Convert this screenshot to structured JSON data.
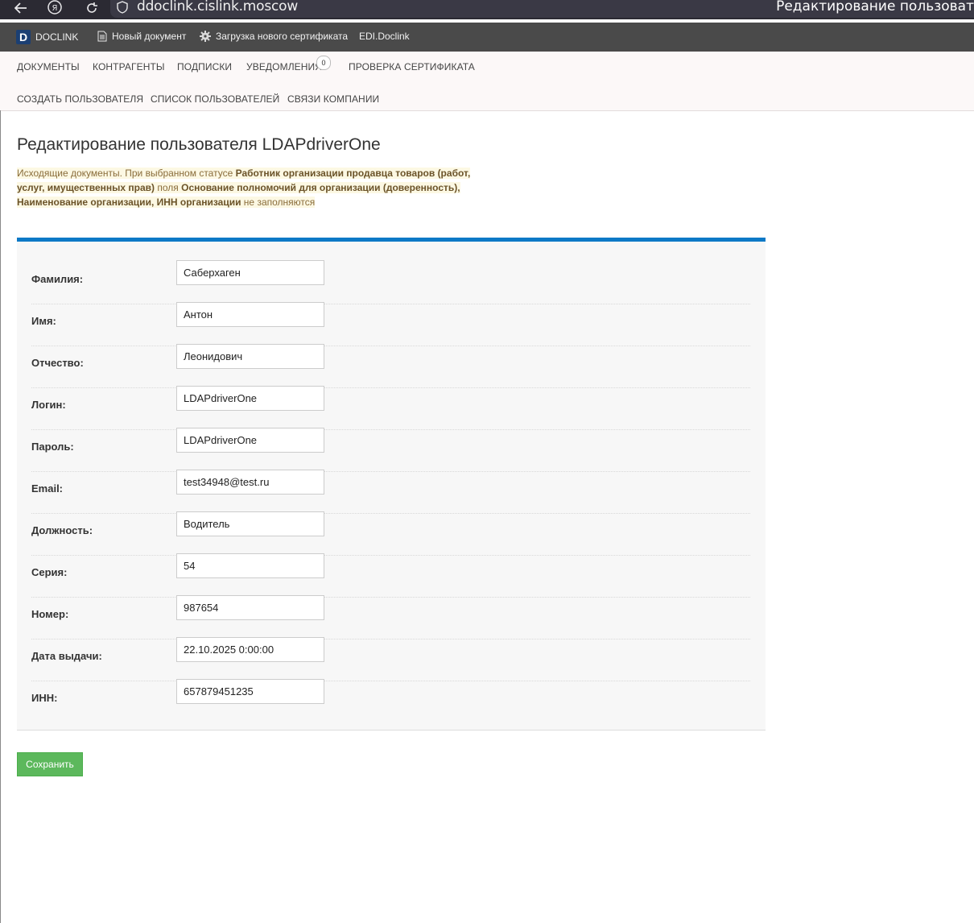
{
  "browser": {
    "url": "ddoclink.cislink.moscow",
    "window_title": "Редактирование пользоват"
  },
  "bookmarks": {
    "items": [
      {
        "label": "DOCLINK",
        "icon": "doclink-logo-icon"
      },
      {
        "label": "Новый документ",
        "icon": "document-icon"
      },
      {
        "label": "Загрузка нового сертификата",
        "icon": "gear-icon"
      },
      {
        "label": "EDI.Doclink"
      }
    ]
  },
  "nav": {
    "row1": [
      "ДОКУМЕНТЫ",
      "КОНТРАГЕНТЫ",
      "ПОДПИСКИ",
      "УВЕДОМЛЕНИЯ",
      "ПРОВЕРКА СЕРТИФИКАТА"
    ],
    "notifications_count": "0",
    "row2": [
      "СОЗДАТЬ ПОЛЬЗОВАТЕЛЯ",
      "СПИСОК ПОЛЬЗОВАТЕЛЕЙ",
      "СВЯЗИ КОМПАНИИ"
    ]
  },
  "page": {
    "title": "Редактирование пользователя LDAPdriverOne",
    "notice": {
      "p1": "Исходящие документы. При выбранном статусе ",
      "b1a": "Работник организации продавца товаров (работ,",
      "b1b": "услуг, имущественных прав)",
      "p2": " поля ",
      "b2": "Основание полномочий для организации (доверенность),",
      "b3": "Наименование организации, ИНН организации",
      "p3": " не заполняются"
    }
  },
  "form": {
    "fields": [
      {
        "label": "Фамилия:",
        "value": "Саберхаген"
      },
      {
        "label": "Имя:",
        "value": "Антон"
      },
      {
        "label": "Отчество:",
        "value": "Леонидович"
      },
      {
        "label": "Логин:",
        "value": "LDAPdriverOne"
      },
      {
        "label": "Пароль:",
        "value": "LDAPdriverOne"
      },
      {
        "label": "Email:",
        "value": "test34948@test.ru"
      },
      {
        "label": "Должность:",
        "value": "Водитель"
      },
      {
        "label": "Серия:",
        "value": "54"
      },
      {
        "label": "Номер:",
        "value": "987654"
      },
      {
        "label": "Дата выдачи:",
        "value": "22.10.2025 0:00:00"
      },
      {
        "label": "ИНН:",
        "value": "657879451235"
      }
    ],
    "save_label": "Сохранить"
  },
  "colors": {
    "accent": "#0d79c6",
    "save_button": "#5cb85c",
    "notice_bg": "#fcf8e3",
    "notice_text": "#8a6d3b"
  }
}
